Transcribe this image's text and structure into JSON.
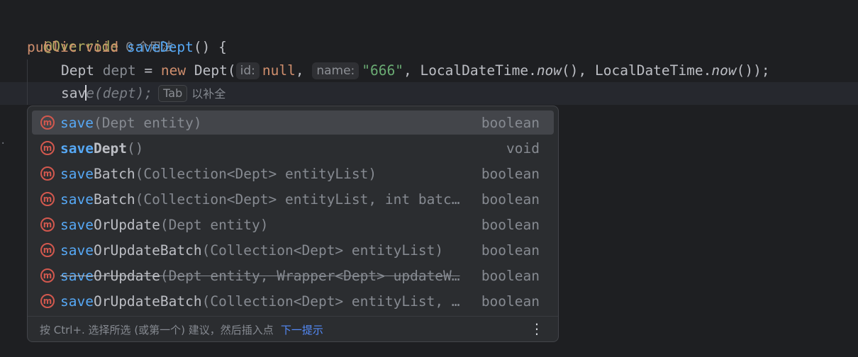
{
  "editor": {
    "annotation": "@Override",
    "usage_hint": "0 个用法",
    "signature": {
      "kw_public": "public",
      "kw_void": "void",
      "method": "saveDept",
      "rest": "() {"
    },
    "line3": {
      "type": "Dept",
      "var": "dept",
      "eq": " = ",
      "kw_new": "new",
      "ctor": " Dept(",
      "hint_id": "id:",
      "null_kw": "null",
      "comma1": ", ",
      "hint_name": "name:",
      "str": "\"666\"",
      "rest1": ", LocalDateTime.",
      "now1": "now",
      "rest2": "(), LocalDateTime.",
      "now2": "now",
      "rest3": "());"
    },
    "line4": {
      "typed_before": "sav",
      "ghost": "e(dept);",
      "tab_key": "Tab",
      "tab_hint": "以补全"
    }
  },
  "completion": {
    "items": [
      {
        "match": "save",
        "rest": "",
        "params": "(Dept entity)",
        "type": "boolean"
      },
      {
        "match": "save",
        "rest": "Dept",
        "params": "()",
        "type": "void"
      },
      {
        "match": "save",
        "rest": "Batch",
        "params": "(Collection<Dept> entityList)",
        "type": "boolean"
      },
      {
        "match": "save",
        "rest": "Batch",
        "params": "(Collection<Dept> entityList, int batc…",
        "type": "boolean"
      },
      {
        "match": "save",
        "rest": "OrUpdate",
        "params": "(Dept entity)",
        "type": "boolean"
      },
      {
        "match": "save",
        "rest": "OrUpdateBatch",
        "params": "(Collection<Dept> entityList)",
        "type": "boolean"
      },
      {
        "match": "save",
        "rest": "OrUpdate",
        "params": "(Dept entity, Wrapper<Dept> updateW…",
        "type": "boolean"
      },
      {
        "match": "save",
        "rest": "OrUpdateBatch",
        "params": "(Collection<Dept> entityList, …",
        "type": "boolean"
      }
    ],
    "method_icon_letter": "m",
    "footer_text": "按 Ctrl+. 选择所选 (或第一个) 建议，然后插入点",
    "footer_link": "下一提示",
    "more_icon": "⋮"
  }
}
